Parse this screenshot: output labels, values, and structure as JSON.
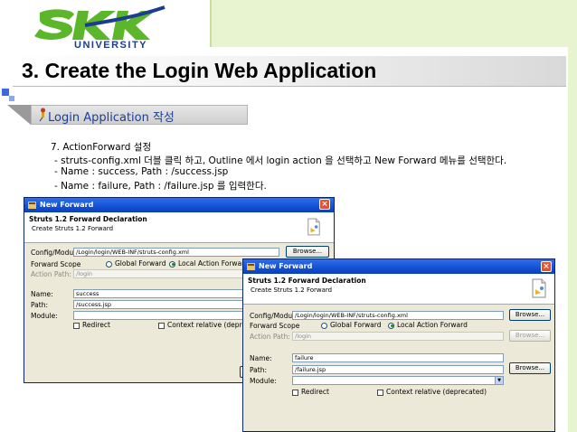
{
  "logo": {
    "text": "SKK",
    "subtitle": "UNIVERSITY"
  },
  "slide": {
    "title": "3. Create the Login Web Application",
    "subtitle": "Login Application 작성",
    "step": "7. ActionForward 설정",
    "bullets": [
      "- struts-config.xml 더블 클릭 하고, Outline 에서 login action 을 선택하고 New Forward 메뉴를 선택한다.",
      "- Name : success, Path : /success.jsp",
      "- Name : failure, Path : /failure.jsp 를 입력한다."
    ]
  },
  "colors": {
    "brand_green": "#5bb62a",
    "brand_blue": "#1a3d8f",
    "title_accent": "#3a6bd6",
    "xp_titlebar": "#1250d4"
  },
  "dialog1": {
    "window_title": "New Forward",
    "header_title": "Struts 1.2 Forward Declaration",
    "header_desc": "Create Struts 1.2 Forward",
    "config_label": "Config/Module:",
    "config_value": "/Login/login/WEB-INF/struts-config.xml",
    "browse_label": "Browse...",
    "scope_label": "Forward Scope",
    "scope_global": "Global Forward",
    "scope_local": "Local Action Forward",
    "action_path_label": "Action Path:",
    "action_path_value": "/login",
    "name_label": "Name:",
    "name_value": "success",
    "path_label": "Path:",
    "path_value": "/success.jsp",
    "module_label": "Module:",
    "redirect_label": "Redirect",
    "context_label": "Context relative (deprecated)"
  },
  "dialog2": {
    "window_title": "New Forward",
    "header_title": "Struts 1.2 Forward Declaration",
    "header_desc": "Create Struts 1.2 Forward",
    "config_label": "Config/Module:",
    "config_value": "/Login/login/WEB-INF/struts-config.xml",
    "browse_label": "Browse...",
    "scope_label": "Forward Scope",
    "scope_global": "Global Forward",
    "scope_local": "Local Action Forward",
    "action_path_label": "Action Path:",
    "action_path_value": "/login",
    "name_label": "Name:",
    "name_value": "failure",
    "path_label": "Path:",
    "path_value": "/failure.jsp",
    "module_label": "Module:",
    "redirect_label": "Redirect",
    "context_label": "Context relative (deprecated)"
  }
}
